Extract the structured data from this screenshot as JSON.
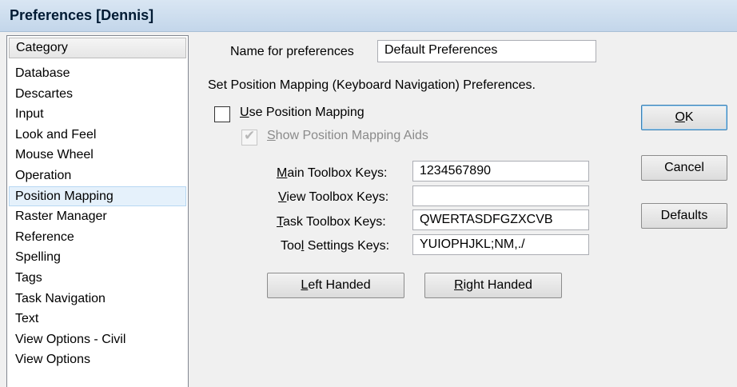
{
  "window": {
    "title": "Preferences [Dennis]"
  },
  "category": {
    "header": "Category",
    "items": [
      "Database",
      "Descartes",
      "Input",
      "Look and Feel",
      "Mouse Wheel",
      "Operation",
      "Position Mapping",
      "Raster Manager",
      "Reference",
      "Spelling",
      "Tags",
      "Task Navigation",
      "Text",
      "View Options - Civil",
      "View Options"
    ],
    "selected": "Position Mapping"
  },
  "prefs_name": {
    "label": "Name for preferences",
    "value": "Default Preferences"
  },
  "section": {
    "heading": "Set Position Mapping (Keyboard Navigation) Preferences."
  },
  "use_position_mapping": {
    "label_u": "U",
    "label_rest": "se Position Mapping",
    "checked": false
  },
  "show_aids": {
    "label_u": "S",
    "label_rest": "how Position Mapping Aids",
    "checked": true,
    "disabled": true
  },
  "keys": {
    "main": {
      "label_u": "M",
      "label_rest": "ain Toolbox Keys:",
      "value": "1234567890"
    },
    "view": {
      "label_u": "V",
      "label_rest": "iew Toolbox Keys:",
      "value": ""
    },
    "task": {
      "label_u": "T",
      "label_rest": "ask Toolbox Keys:",
      "value": "QWERTASDFGZXCVB"
    },
    "tool": {
      "label_pre": "Too",
      "label_u": "l",
      "label_rest": " Settings Keys:",
      "value": "YUIOPHJKL;NM,./"
    }
  },
  "buttons": {
    "left_u": "L",
    "left_rest": "eft Handed",
    "right_u": "R",
    "right_rest": "ight Handed",
    "ok_u": "O",
    "ok_rest": "K",
    "cancel": "Cancel",
    "defaults": "Defaults"
  }
}
